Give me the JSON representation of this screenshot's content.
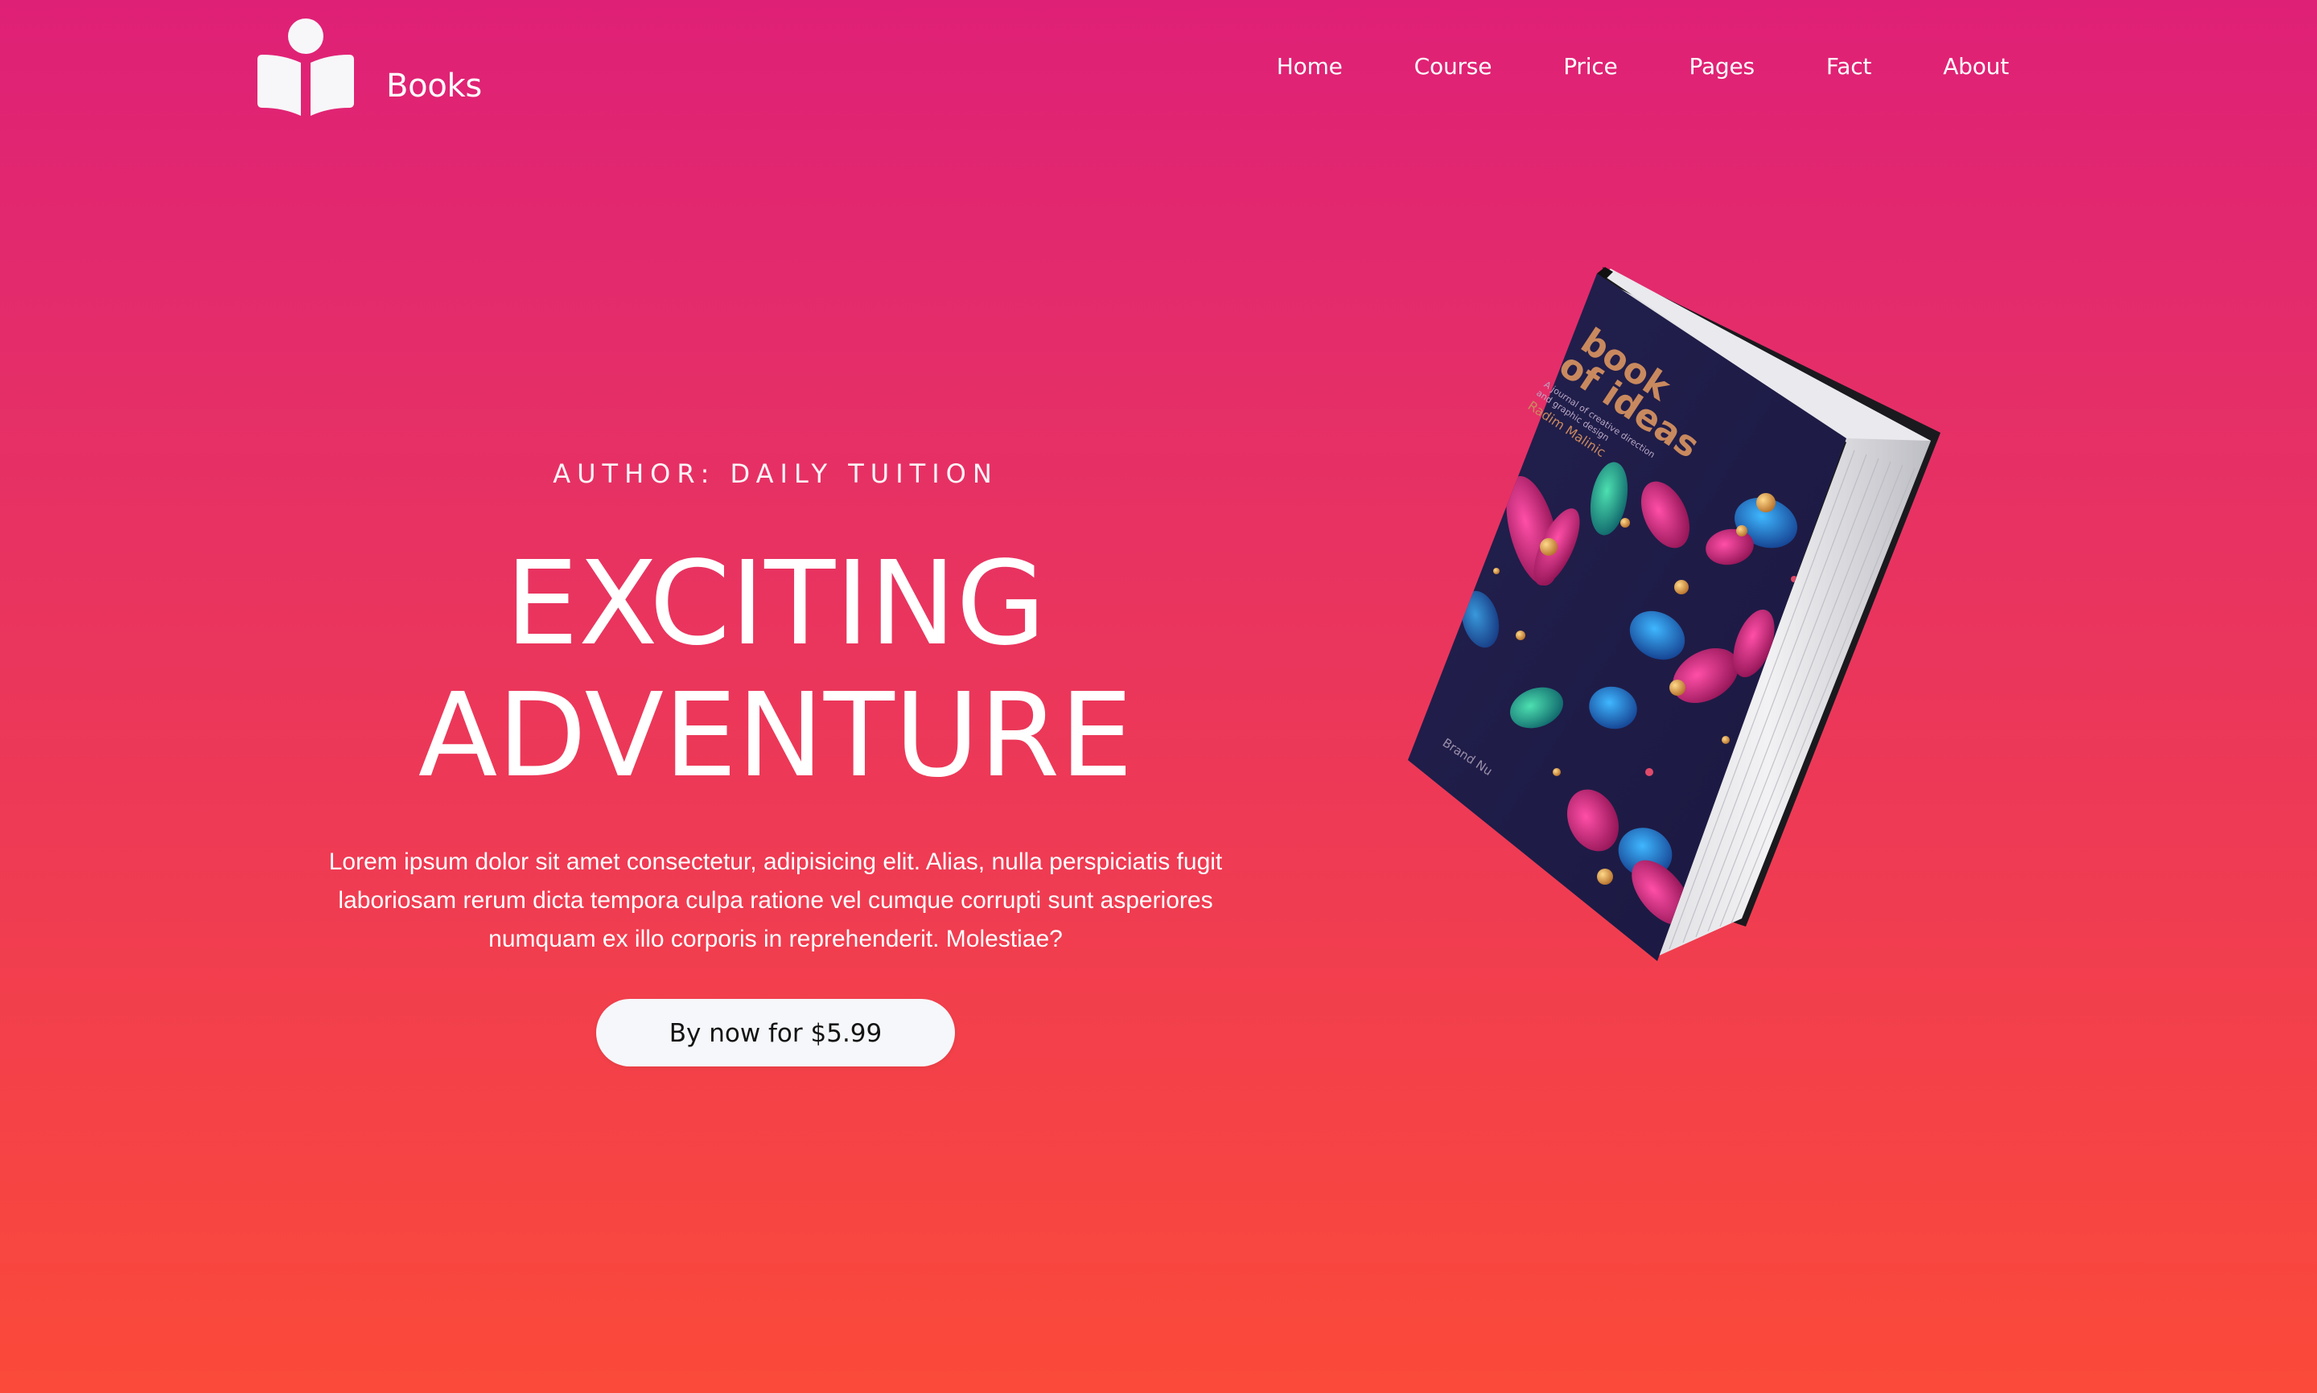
{
  "brand": {
    "name": "Books",
    "logo_icon": "open-book-reader-icon"
  },
  "nav": {
    "items": [
      "Home",
      "Course",
      "Price",
      "Pages",
      "Fact",
      "About"
    ]
  },
  "hero": {
    "author": "AUTHOR: DAILY TUITION",
    "title_line1": "EXCITING",
    "title_line2": "ADVENTURE",
    "description": "Lorem ipsum dolor sit amet consectetur, adipisicing elit. Alias, nulla perspiciatis fugit laboriosam rerum dicta tempora culpa ratione vel cumque corrupti sunt asperiores numquam ex illo corporis in reprehenderit. Molestiae?",
    "cta_label": "By now for $5.99"
  },
  "book": {
    "cover_title_line1": "book",
    "cover_title_line2": "of ideas",
    "cover_subtitle_line1": "A journal of creative direction",
    "cover_subtitle_line2": "and graphic design",
    "cover_author": "Radim Malinic",
    "cover_publisher": "Brand Nu"
  },
  "colors": {
    "gradient_top": "#df2077",
    "gradient_bottom": "#fb4a39",
    "button_bg": "#f6f7fa",
    "cover_bg": "#1f1c47",
    "cover_title": "#c9895e"
  }
}
